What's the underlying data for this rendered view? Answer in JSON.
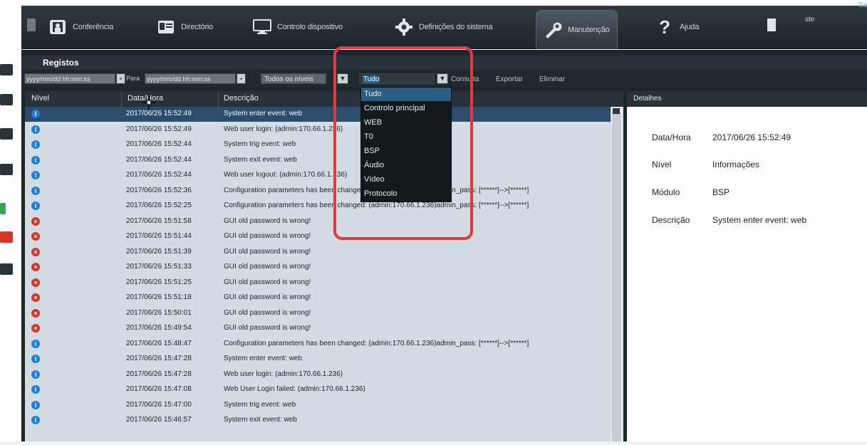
{
  "nav": {
    "items": [
      {
        "label": "Conferência",
        "icon": "presentation-icon"
      },
      {
        "label": "Directório",
        "icon": "contact-card-icon"
      },
      {
        "label": "Controlo dispositivo",
        "icon": "monitor-icon"
      },
      {
        "label": "Definições do sistema",
        "icon": "gear-icon"
      },
      {
        "label": "Manutenção",
        "icon": "wrench-icon"
      },
      {
        "label": "Ajuda",
        "icon": "question-icon"
      }
    ],
    "user": "ste",
    "corner_text": "Sa"
  },
  "panel": {
    "title": "Registos"
  },
  "filters": {
    "from_placeholder": "yyyy/mm/dd hh:mm:ss",
    "to_label": "Para",
    "to_placeholder": "yyyy/mm/dd hh:mm:ss",
    "level_select": "Todos os níveis",
    "module_select": "Tudo",
    "query": "Consulta",
    "export": "Exportar",
    "delete": "Eliminar"
  },
  "table": {
    "columns": [
      "Nível",
      "Data/Hora",
      "Descrição"
    ],
    "rows": [
      {
        "level": "info",
        "datetime": "2017/06/26 15:52:49",
        "desc": "System enter event: web",
        "selected": true
      },
      {
        "level": "info",
        "datetime": "2017/06/26 15:52:49",
        "desc": "Web user login: (admin:170.66.1.236)"
      },
      {
        "level": "info",
        "datetime": "2017/06/26 15:52:44",
        "desc": "System trig event: web"
      },
      {
        "level": "info",
        "datetime": "2017/06/26 15:52:44",
        "desc": "System exit event: web"
      },
      {
        "level": "info",
        "datetime": "2017/06/26 15:52:44",
        "desc": "Web user logout: (admin:170.66.1.236)"
      },
      {
        "level": "info",
        "datetime": "2017/06/26 15:52:36",
        "desc": "Configuration parameters has been changed: (admin:170.66.1.236)admin_pass: [******]-->[******]"
      },
      {
        "level": "info",
        "datetime": "2017/06/26 15:52:25",
        "desc": "Configuration parameters has been changed: (admin:170.66.1.236)admin_pass: [******]-->[******]"
      },
      {
        "level": "error",
        "datetime": "2017/06/26 15:51:58",
        "desc": "GUI old password is wrong!"
      },
      {
        "level": "error",
        "datetime": "2017/06/26 15:51:44",
        "desc": "GUI old password is wrong!"
      },
      {
        "level": "error",
        "datetime": "2017/06/26 15:51:39",
        "desc": "GUI old password is wrong!"
      },
      {
        "level": "error",
        "datetime": "2017/06/26 15:51:33",
        "desc": "GUI old password is wrong!"
      },
      {
        "level": "error",
        "datetime": "2017/06/26 15:51:25",
        "desc": "GUI old password is wrong!"
      },
      {
        "level": "error",
        "datetime": "2017/06/26 15:51:18",
        "desc": "GUI old password is wrong!"
      },
      {
        "level": "error",
        "datetime": "2017/06/26 15:50:01",
        "desc": "GUI old password is wrong!"
      },
      {
        "level": "error",
        "datetime": "2017/06/26 15:49:54",
        "desc": "GUI old password is wrong!"
      },
      {
        "level": "info",
        "datetime": "2017/06/26 15:48:47",
        "desc": "Configuration parameters has been changed: (admin:170.66.1.236)admin_pass: [******]-->[******]"
      },
      {
        "level": "info",
        "datetime": "2017/06/26 15:47:28",
        "desc": "System enter event: web"
      },
      {
        "level": "info",
        "datetime": "2017/06/26 15:47:28",
        "desc": "Web user login: (admin:170.66.1.236)"
      },
      {
        "level": "info",
        "datetime": "2017/06/26 15:47:08",
        "desc": "Web User Login failed: (admin:170.66.1.236)"
      },
      {
        "level": "info",
        "datetime": "2017/06/26 15:47:00",
        "desc": "System trig event: web"
      },
      {
        "level": "info",
        "datetime": "2017/06/26 15:46:57",
        "desc": "System exit event: web"
      }
    ]
  },
  "dropdown": {
    "options": [
      "Tudo",
      "Controlo principal",
      "WEB",
      "T0",
      "BSP",
      "Áudio",
      "Vídeo",
      "Protocolo"
    ],
    "highlighted": "Tudo"
  },
  "details": {
    "title": "Detalhes",
    "fields": [
      {
        "label": "Data/Hora",
        "value": "2017/06/26 15:52:49"
      },
      {
        "label": "Nível",
        "value": "Informações"
      },
      {
        "label": "Módulo",
        "value": "BSP"
      },
      {
        "label": "Descrição",
        "value": "System enter event: web"
      }
    ]
  },
  "colors": {
    "accent": "#2a5d86",
    "highlight_box": "#e53940",
    "info": "#1e7fd8",
    "error": "#d8342a"
  }
}
